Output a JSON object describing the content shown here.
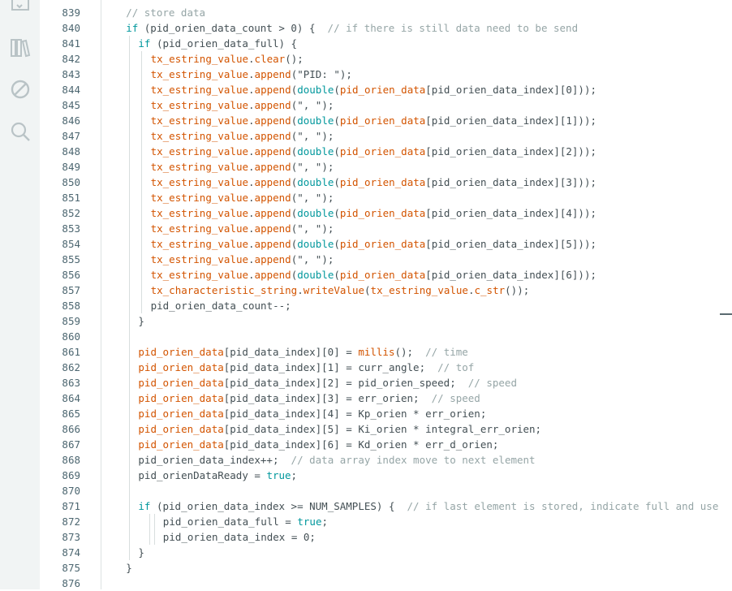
{
  "activity_bar": {
    "icons": [
      "folder-icon",
      "library-icon",
      "debug-icon",
      "search-icon"
    ]
  },
  "line_numbers": [
    "839",
    "840",
    "841",
    "842",
    "843",
    "844",
    "845",
    "846",
    "847",
    "848",
    "849",
    "850",
    "851",
    "852",
    "853",
    "854",
    "855",
    "856",
    "857",
    "858",
    "859",
    "860",
    "861",
    "862",
    "863",
    "864",
    "865",
    "866",
    "867",
    "868",
    "869",
    "870",
    "871",
    "872",
    "873",
    "874",
    "875",
    "876"
  ],
  "code_lines": [
    {
      "indent": 1,
      "tokens": [
        [
          "c",
          "// store data"
        ]
      ]
    },
    {
      "indent": 1,
      "tokens": [
        [
          "k",
          "if"
        ],
        [
          "n",
          " (pid_orien_data_count > 0) {  "
        ],
        [
          "c",
          "// if there is still data need to be send"
        ]
      ]
    },
    {
      "indent": 2,
      "tokens": [
        [
          "k",
          "if"
        ],
        [
          "n",
          " (pid_orien_data_full) {"
        ]
      ]
    },
    {
      "indent": 3,
      "tokens": [
        [
          "v",
          "tx_estring_value"
        ],
        [
          "n",
          "."
        ],
        [
          "f",
          "clear"
        ],
        [
          "n",
          "();"
        ]
      ]
    },
    {
      "indent": 3,
      "tokens": [
        [
          "v",
          "tx_estring_value"
        ],
        [
          "n",
          "."
        ],
        [
          "f",
          "append"
        ],
        [
          "n",
          "(\"PID: \");"
        ]
      ]
    },
    {
      "indent": 3,
      "tokens": [
        [
          "v",
          "tx_estring_value"
        ],
        [
          "n",
          "."
        ],
        [
          "f",
          "append"
        ],
        [
          "n",
          "("
        ],
        [
          "k",
          "double"
        ],
        [
          "n",
          "("
        ],
        [
          "v",
          "pid_orien_data"
        ],
        [
          "n",
          "[pid_orien_data_index][0]));"
        ]
      ]
    },
    {
      "indent": 3,
      "tokens": [
        [
          "v",
          "tx_estring_value"
        ],
        [
          "n",
          "."
        ],
        [
          "f",
          "append"
        ],
        [
          "n",
          "(\", \");"
        ]
      ]
    },
    {
      "indent": 3,
      "tokens": [
        [
          "v",
          "tx_estring_value"
        ],
        [
          "n",
          "."
        ],
        [
          "f",
          "append"
        ],
        [
          "n",
          "("
        ],
        [
          "k",
          "double"
        ],
        [
          "n",
          "("
        ],
        [
          "v",
          "pid_orien_data"
        ],
        [
          "n",
          "[pid_orien_data_index][1]));"
        ]
      ]
    },
    {
      "indent": 3,
      "tokens": [
        [
          "v",
          "tx_estring_value"
        ],
        [
          "n",
          "."
        ],
        [
          "f",
          "append"
        ],
        [
          "n",
          "(\", \");"
        ]
      ]
    },
    {
      "indent": 3,
      "tokens": [
        [
          "v",
          "tx_estring_value"
        ],
        [
          "n",
          "."
        ],
        [
          "f",
          "append"
        ],
        [
          "n",
          "("
        ],
        [
          "k",
          "double"
        ],
        [
          "n",
          "("
        ],
        [
          "v",
          "pid_orien_data"
        ],
        [
          "n",
          "[pid_orien_data_index][2]));"
        ]
      ]
    },
    {
      "indent": 3,
      "tokens": [
        [
          "v",
          "tx_estring_value"
        ],
        [
          "n",
          "."
        ],
        [
          "f",
          "append"
        ],
        [
          "n",
          "(\", \");"
        ]
      ]
    },
    {
      "indent": 3,
      "tokens": [
        [
          "v",
          "tx_estring_value"
        ],
        [
          "n",
          "."
        ],
        [
          "f",
          "append"
        ],
        [
          "n",
          "("
        ],
        [
          "k",
          "double"
        ],
        [
          "n",
          "("
        ],
        [
          "v",
          "pid_orien_data"
        ],
        [
          "n",
          "[pid_orien_data_index][3]));"
        ]
      ]
    },
    {
      "indent": 3,
      "tokens": [
        [
          "v",
          "tx_estring_value"
        ],
        [
          "n",
          "."
        ],
        [
          "f",
          "append"
        ],
        [
          "n",
          "(\", \");"
        ]
      ]
    },
    {
      "indent": 3,
      "tokens": [
        [
          "v",
          "tx_estring_value"
        ],
        [
          "n",
          "."
        ],
        [
          "f",
          "append"
        ],
        [
          "n",
          "("
        ],
        [
          "k",
          "double"
        ],
        [
          "n",
          "("
        ],
        [
          "v",
          "pid_orien_data"
        ],
        [
          "n",
          "[pid_orien_data_index][4]));"
        ]
      ]
    },
    {
      "indent": 3,
      "tokens": [
        [
          "v",
          "tx_estring_value"
        ],
        [
          "n",
          "."
        ],
        [
          "f",
          "append"
        ],
        [
          "n",
          "(\", \");"
        ]
      ]
    },
    {
      "indent": 3,
      "tokens": [
        [
          "v",
          "tx_estring_value"
        ],
        [
          "n",
          "."
        ],
        [
          "f",
          "append"
        ],
        [
          "n",
          "("
        ],
        [
          "k",
          "double"
        ],
        [
          "n",
          "("
        ],
        [
          "v",
          "pid_orien_data"
        ],
        [
          "n",
          "[pid_orien_data_index][5]));"
        ]
      ]
    },
    {
      "indent": 3,
      "tokens": [
        [
          "v",
          "tx_estring_value"
        ],
        [
          "n",
          "."
        ],
        [
          "f",
          "append"
        ],
        [
          "n",
          "(\", \");"
        ]
      ]
    },
    {
      "indent": 3,
      "tokens": [
        [
          "v",
          "tx_estring_value"
        ],
        [
          "n",
          "."
        ],
        [
          "f",
          "append"
        ],
        [
          "n",
          "("
        ],
        [
          "k",
          "double"
        ],
        [
          "n",
          "("
        ],
        [
          "v",
          "pid_orien_data"
        ],
        [
          "n",
          "[pid_orien_data_index][6]));"
        ]
      ]
    },
    {
      "indent": 3,
      "tokens": [
        [
          "v",
          "tx_characteristic_string"
        ],
        [
          "n",
          "."
        ],
        [
          "f",
          "writeValue"
        ],
        [
          "n",
          "("
        ],
        [
          "v",
          "tx_estring_value"
        ],
        [
          "n",
          "."
        ],
        [
          "f",
          "c_str"
        ],
        [
          "n",
          "());"
        ]
      ]
    },
    {
      "indent": 3,
      "tokens": [
        [
          "n",
          "pid_orien_data_count--;"
        ]
      ]
    },
    {
      "indent": 2,
      "tokens": [
        [
          "n",
          "}"
        ]
      ]
    },
    {
      "indent": 0,
      "tokens": []
    },
    {
      "indent": 2,
      "tokens": [
        [
          "v",
          "pid_orien_data"
        ],
        [
          "n",
          "[pid_data_index][0] = "
        ],
        [
          "f",
          "millis"
        ],
        [
          "n",
          "();  "
        ],
        [
          "c",
          "// time"
        ]
      ]
    },
    {
      "indent": 2,
      "tokens": [
        [
          "v",
          "pid_orien_data"
        ],
        [
          "n",
          "[pid_data_index][1] = curr_angle;  "
        ],
        [
          "c",
          "// tof"
        ]
      ]
    },
    {
      "indent": 2,
      "tokens": [
        [
          "v",
          "pid_orien_data"
        ],
        [
          "n",
          "[pid_data_index][2] = pid_orien_speed;  "
        ],
        [
          "c",
          "// speed"
        ]
      ]
    },
    {
      "indent": 2,
      "tokens": [
        [
          "v",
          "pid_orien_data"
        ],
        [
          "n",
          "[pid_data_index][3] = err_orien;  "
        ],
        [
          "c",
          "// speed"
        ]
      ]
    },
    {
      "indent": 2,
      "tokens": [
        [
          "v",
          "pid_orien_data"
        ],
        [
          "n",
          "[pid_data_index][4] = Kp_orien * err_orien;"
        ]
      ]
    },
    {
      "indent": 2,
      "tokens": [
        [
          "v",
          "pid_orien_data"
        ],
        [
          "n",
          "[pid_data_index][5] = Ki_orien * integral_err_orien;"
        ]
      ]
    },
    {
      "indent": 2,
      "tokens": [
        [
          "v",
          "pid_orien_data"
        ],
        [
          "n",
          "[pid_data_index][6] = Kd_orien * err_d_orien;"
        ]
      ]
    },
    {
      "indent": 2,
      "tokens": [
        [
          "n",
          "pid_orien_data_index++;  "
        ],
        [
          "c",
          "// data array index move to next element"
        ]
      ]
    },
    {
      "indent": 2,
      "tokens": [
        [
          "n",
          "pid_orienDataReady = "
        ],
        [
          "k",
          "true"
        ],
        [
          "n",
          ";"
        ]
      ]
    },
    {
      "indent": 0,
      "tokens": []
    },
    {
      "indent": 2,
      "tokens": [
        [
          "k",
          "if"
        ],
        [
          "n",
          " (pid_orien_data_index >= NUM_SAMPLES) {  "
        ],
        [
          "c",
          "// if last element is stored, indicate full and use"
        ]
      ]
    },
    {
      "indent": 4,
      "tokens": [
        [
          "n",
          "pid_orien_data_full = "
        ],
        [
          "k",
          "true"
        ],
        [
          "n",
          ";"
        ]
      ]
    },
    {
      "indent": 4,
      "tokens": [
        [
          "n",
          "pid_orien_data_index = 0;"
        ]
      ]
    },
    {
      "indent": 2,
      "tokens": [
        [
          "n",
          "}"
        ]
      ]
    },
    {
      "indent": 1,
      "tokens": [
        [
          "n",
          "}"
        ]
      ]
    },
    {
      "indent": 0,
      "tokens": []
    }
  ],
  "colors": {
    "comment": "#95a5a6",
    "keyword": "#00979c",
    "variable": "#d35400",
    "function": "#d35400",
    "normal": "#434f54",
    "line_number": "#4c6670"
  }
}
